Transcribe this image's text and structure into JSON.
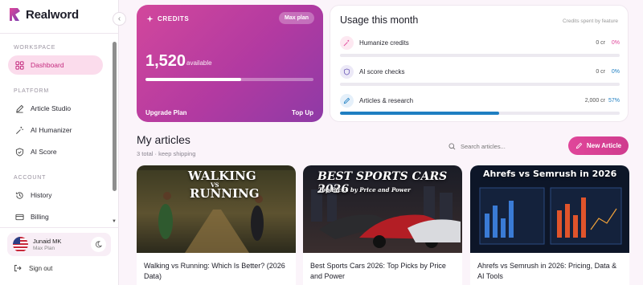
{
  "brand": {
    "name": "Realword"
  },
  "sidebar": {
    "sections": {
      "workspace": "WORKSPACE",
      "platform": "PLATFORM",
      "account": "ACCOUNT"
    },
    "items": [
      {
        "label": "Dashboard",
        "icon": "dashboard-icon",
        "active": true
      },
      {
        "label": "Article Studio",
        "icon": "pen-icon"
      },
      {
        "label": "AI Humanizer",
        "icon": "magic-wand-icon"
      },
      {
        "label": "AI Score",
        "icon": "shield-check-icon"
      },
      {
        "label": "History",
        "icon": "history-icon"
      },
      {
        "label": "Billing",
        "icon": "billing-card-icon"
      }
    ],
    "user": {
      "name": "Junaid MK",
      "plan": "Max Plan"
    },
    "signout": "Sign out"
  },
  "credits": {
    "label": "CREDITS",
    "plan_badge": "Max plan",
    "amount": "1,520",
    "available_label": "available",
    "fill_fraction": 0.57,
    "upgrade_label": "Upgrade Plan",
    "topup_label": "Top Up"
  },
  "usage": {
    "title": "Usage this month",
    "subtitle": "Credits spent by feature",
    "rows": [
      {
        "name": "Humanize credits",
        "credits": "0 cr",
        "pct": "0%",
        "fraction": 0,
        "pct_color": "#e0469a",
        "icon": "humanize-icon"
      },
      {
        "name": "AI score checks",
        "credits": "0 cr",
        "pct": "0%",
        "fraction": 0,
        "pct_color": "#1f7fc2",
        "icon": "shield-icon"
      },
      {
        "name": "Articles & research",
        "credits": "2,000 cr",
        "pct": "57%",
        "fraction": 0.57,
        "pct_color": "#1f7fc2",
        "icon": "pencil-icon"
      }
    ]
  },
  "articles": {
    "title": "My articles",
    "subtitle": "3 total · keep shipping",
    "search_placeholder": "Search articles...",
    "new_button": "New Article",
    "items": [
      {
        "title": "Walking vs Running: Which Is Better? (2026 Data)",
        "thumb_line1": "WALKING",
        "thumb_line2": "VS",
        "thumb_line3": "RUNNING"
      },
      {
        "title": "Best Sports Cars 2026: Top Picks by Price and Power",
        "thumb_line1": "BEST SPORTS CARS 2026",
        "thumb_line2": "Top Picks by Price and Power"
      },
      {
        "title": "Ahrefs vs Semrush in 2026: Pricing, Data & AI Tools",
        "thumb_line1": "Ahrefs vs Semrush in 2026"
      }
    ]
  }
}
